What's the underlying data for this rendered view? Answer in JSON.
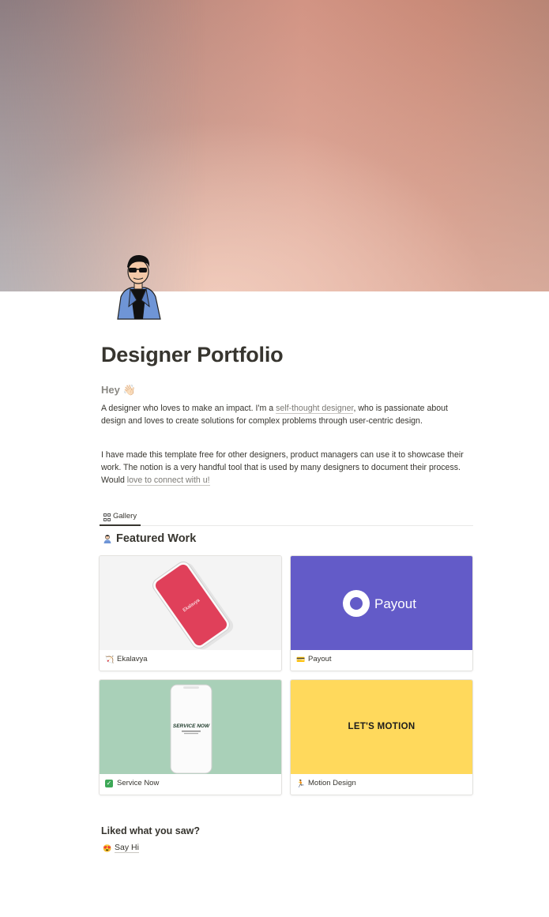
{
  "page": {
    "title": "Designer Portfolio",
    "greeting": "Hey 👋🏻",
    "intro_before": "A designer who loves to make an impact. I'm a ",
    "intro_link": "self-thought designer",
    "intro_after": ", who is passionate about design and loves to create solutions for complex problems through user-centric design.",
    "para2_before": "I have made this template free for other designers, product managers can use it to showcase their work. The notion is a very handful tool that is used by many designers to document their process. Would ",
    "para2_link": "love to connect with u!"
  },
  "gallery": {
    "tab_label": "Gallery",
    "section_title": "Featured Work",
    "cards": [
      {
        "label": "Ekalavya",
        "image_text": "Ekalavya"
      },
      {
        "label": "Payout",
        "image_text": "Payout"
      },
      {
        "label": "Service Now",
        "image_text": "SERVICE NOW"
      },
      {
        "label": "Motion Design",
        "image_text": "LET'S MOTION"
      }
    ]
  },
  "footer": {
    "heading": "Liked what you saw?",
    "link_label": "Say Hi"
  },
  "colors": {
    "payout_bg": "#635bc8",
    "service_bg": "#a9d0b8",
    "motion_bg": "#ffd95c",
    "ekalavya_phone": "#e0405a"
  }
}
